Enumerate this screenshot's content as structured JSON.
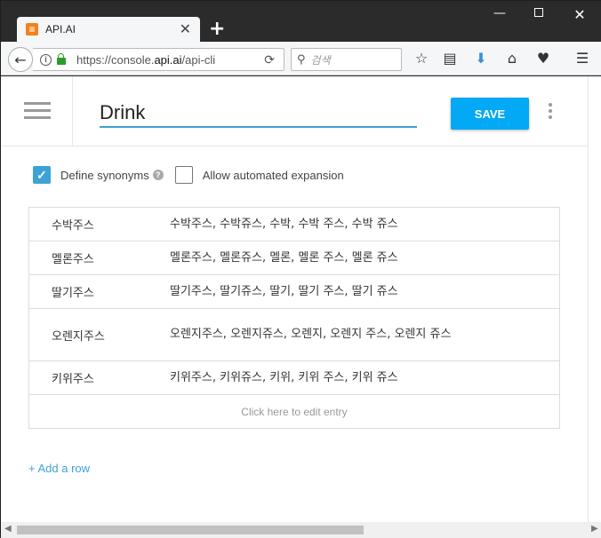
{
  "browser": {
    "tab_title": "API.AI",
    "new_tab": "+",
    "url_host_prefix": "https://console.",
    "url_host": "api.ai",
    "url_path": "/api-cli",
    "search_placeholder": "검색"
  },
  "entity": {
    "name": "Drink",
    "save_label": "SAVE"
  },
  "options": {
    "define_synonyms": {
      "label": "Define synonyms",
      "checked": true
    },
    "automated_expansion": {
      "label": "Allow automated expansion",
      "checked": false
    }
  },
  "entries": [
    {
      "value": "수박주스",
      "synonyms": "수박주스, 수박쥬스, 수박, 수박 주스, 수박 쥬스"
    },
    {
      "value": "멜론주스",
      "synonyms": "멜론주스, 멜론쥬스, 멜론, 멜론 주스, 멜론 쥬스"
    },
    {
      "value": "딸기주스",
      "synonyms": "딸기주스, 딸기쥬스, 딸기, 딸기 주스, 딸기 쥬스"
    },
    {
      "value": "오렌지주스",
      "synonyms": "오렌지주스, 오렌지쥬스, 오렌지, 오렌지 주스, 오렌지 쥬스"
    },
    {
      "value": "키위주스",
      "synonyms": "키위주스, 키위쥬스, 키위, 키위 주스, 키위 쥬스"
    }
  ],
  "edit_placeholder": "Click here to edit entry",
  "add_row_label": "+ Add a row",
  "colors": {
    "accent": "#03a9f4",
    "link": "#3da2d6",
    "favicon": "#f0831c"
  }
}
